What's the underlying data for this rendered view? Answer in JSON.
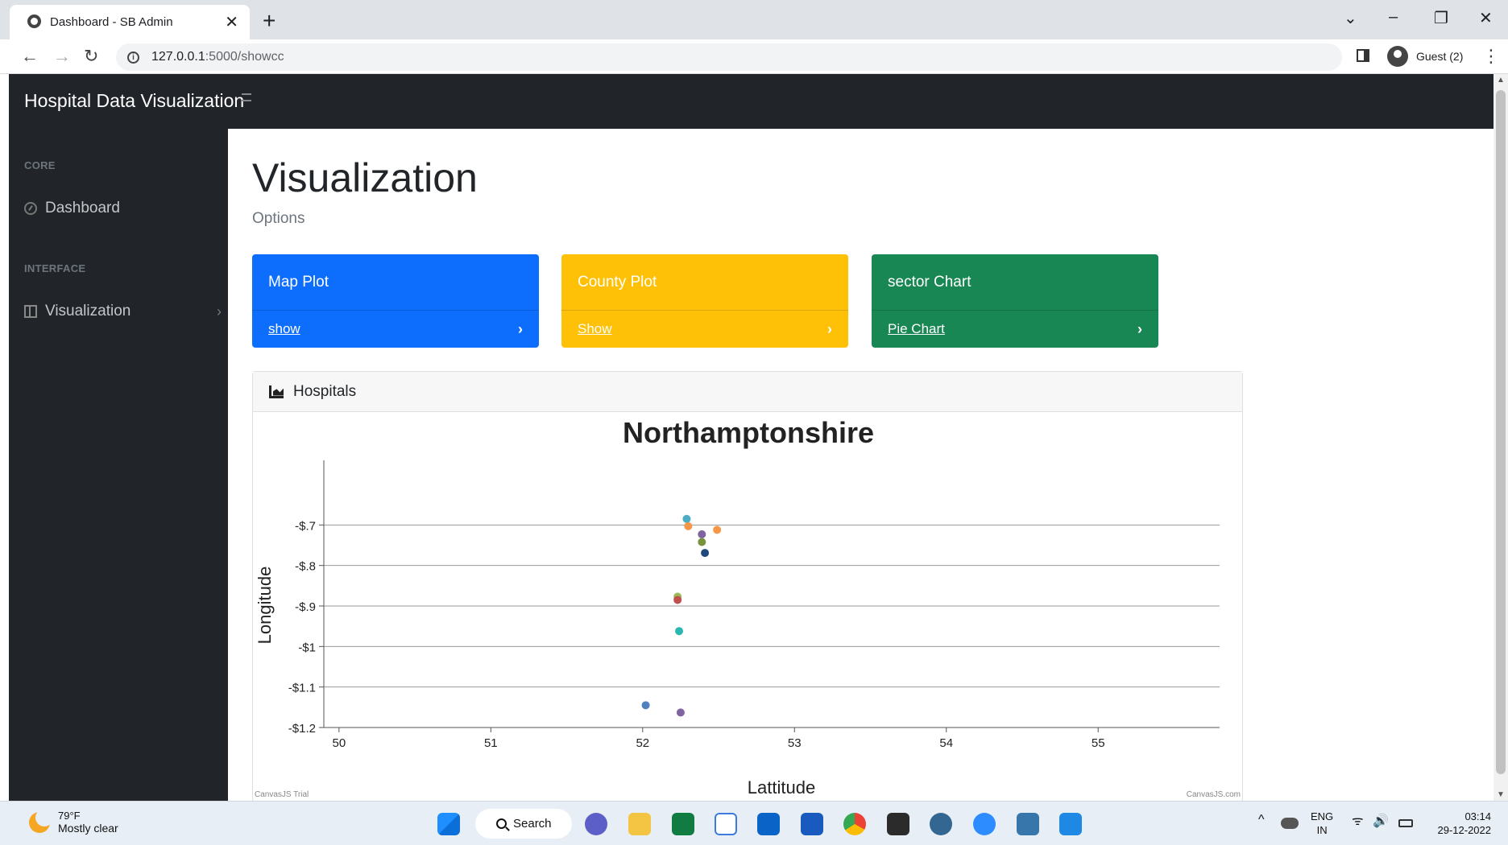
{
  "browser": {
    "tab_title": "Dashboard - SB Admin",
    "url_host": "127.0.0.1",
    "url_path": ":5000/showcc",
    "profile_label": "Guest (2)"
  },
  "app": {
    "brand": "Hospital Data Visualization"
  },
  "sidebar": {
    "heading_core": "CORE",
    "dashboard": "Dashboard",
    "heading_interface": "INTERFACE",
    "visualization": "Visualization"
  },
  "page": {
    "title": "Visualization",
    "subtitle": "Options"
  },
  "cards": [
    {
      "title": "Map Plot",
      "link": "show",
      "color": "#0d6efd"
    },
    {
      "title": "County Plot",
      "link": "Show",
      "color": "#ffc107"
    },
    {
      "title": "sector Chart",
      "link": "Pie Chart",
      "color": "#198754"
    }
  ],
  "chart_card": {
    "header": "Hospitals",
    "watermark_left": "CanvasJS Trial",
    "watermark_right": "CanvasJS.com"
  },
  "chart_data": {
    "type": "scatter",
    "title": "Northamptonshire",
    "xlabel": "Lattitude",
    "ylabel": "Longitude",
    "xlim": [
      49.9,
      55.8
    ],
    "ylim": [
      -1.2,
      -0.6
    ],
    "x_ticks": [
      50,
      51,
      52,
      53,
      54,
      55
    ],
    "x_tick_labels": [
      "50",
      "51",
      "52",
      "53",
      "54",
      "55"
    ],
    "y_ticks": [
      -0.7,
      -0.8,
      -0.9,
      -1.0,
      -1.1,
      -1.2
    ],
    "y_tick_labels": [
      "-$.7",
      "-$.8",
      "-$.9",
      "-$1",
      "-$1.1",
      "-$1.2"
    ],
    "grid": true,
    "points": [
      {
        "x": 52.29,
        "y": -0.685,
        "color": "#4bacc6"
      },
      {
        "x": 52.3,
        "y": -0.703,
        "color": "#f79646"
      },
      {
        "x": 52.49,
        "y": -0.712,
        "color": "#f79646"
      },
      {
        "x": 52.39,
        "y": -0.723,
        "color": "#8064a2"
      },
      {
        "x": 52.39,
        "y": -0.742,
        "color": "#77933c"
      },
      {
        "x": 52.41,
        "y": -0.769,
        "color": "#1f497d"
      },
      {
        "x": 52.23,
        "y": -0.877,
        "color": "#9bbb59"
      },
      {
        "x": 52.23,
        "y": -0.885,
        "color": "#c0504d"
      },
      {
        "x": 52.24,
        "y": -0.962,
        "color": "#2ab7b0"
      },
      {
        "x": 52.02,
        "y": -1.145,
        "color": "#4f81bd"
      },
      {
        "x": 52.25,
        "y": -1.163,
        "color": "#8064a2"
      }
    ]
  },
  "taskbar": {
    "temp": "79°F",
    "weather": "Mostly clear",
    "search": "Search",
    "lang1": "ENG",
    "lang2": "IN",
    "time": "03:14",
    "date": "29-12-2022"
  }
}
